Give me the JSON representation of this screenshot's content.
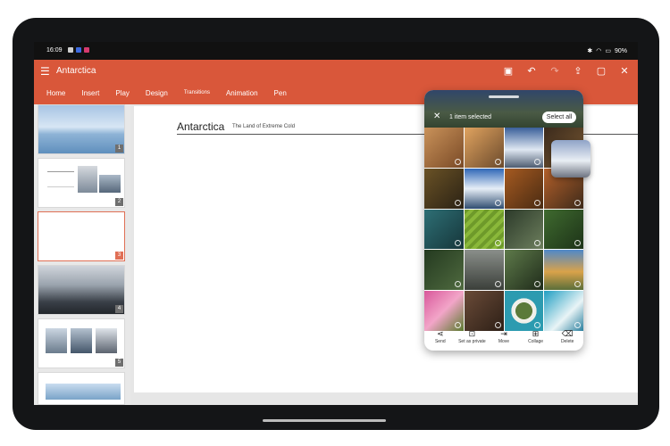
{
  "status": {
    "time": "16:09",
    "battery": "90%"
  },
  "app": {
    "title": "Antarctica",
    "menu_icon": "hamburger-icon",
    "toolbar_icons": [
      "save-icon",
      "undo-icon",
      "redo-icon",
      "share-icon",
      "present-icon",
      "close-icon"
    ]
  },
  "ribbon": {
    "tabs": [
      "Home",
      "Insert",
      "Play",
      "Design",
      "Transitions",
      "Animation",
      "Pen"
    ]
  },
  "thumbnails": {
    "numbers": [
      "1",
      "2",
      "3",
      "4",
      "5"
    ],
    "selected": "3"
  },
  "slide": {
    "title": "Antarctica",
    "subtitle": "The Land of Extreme Cold"
  },
  "gallery": {
    "selected_count": "1 item selected",
    "select_all": "Select all",
    "actions": [
      {
        "label": "Send",
        "icon": "share-icon"
      },
      {
        "label": "Set as private",
        "icon": "lock-icon"
      },
      {
        "label": "Move",
        "icon": "move-icon"
      },
      {
        "label": "Collage",
        "icon": "collage-icon"
      },
      {
        "label": "Delete",
        "icon": "trash-icon"
      }
    ]
  },
  "colors": {
    "accent": "#d9573a",
    "thumb_selected": "#e06f55"
  }
}
